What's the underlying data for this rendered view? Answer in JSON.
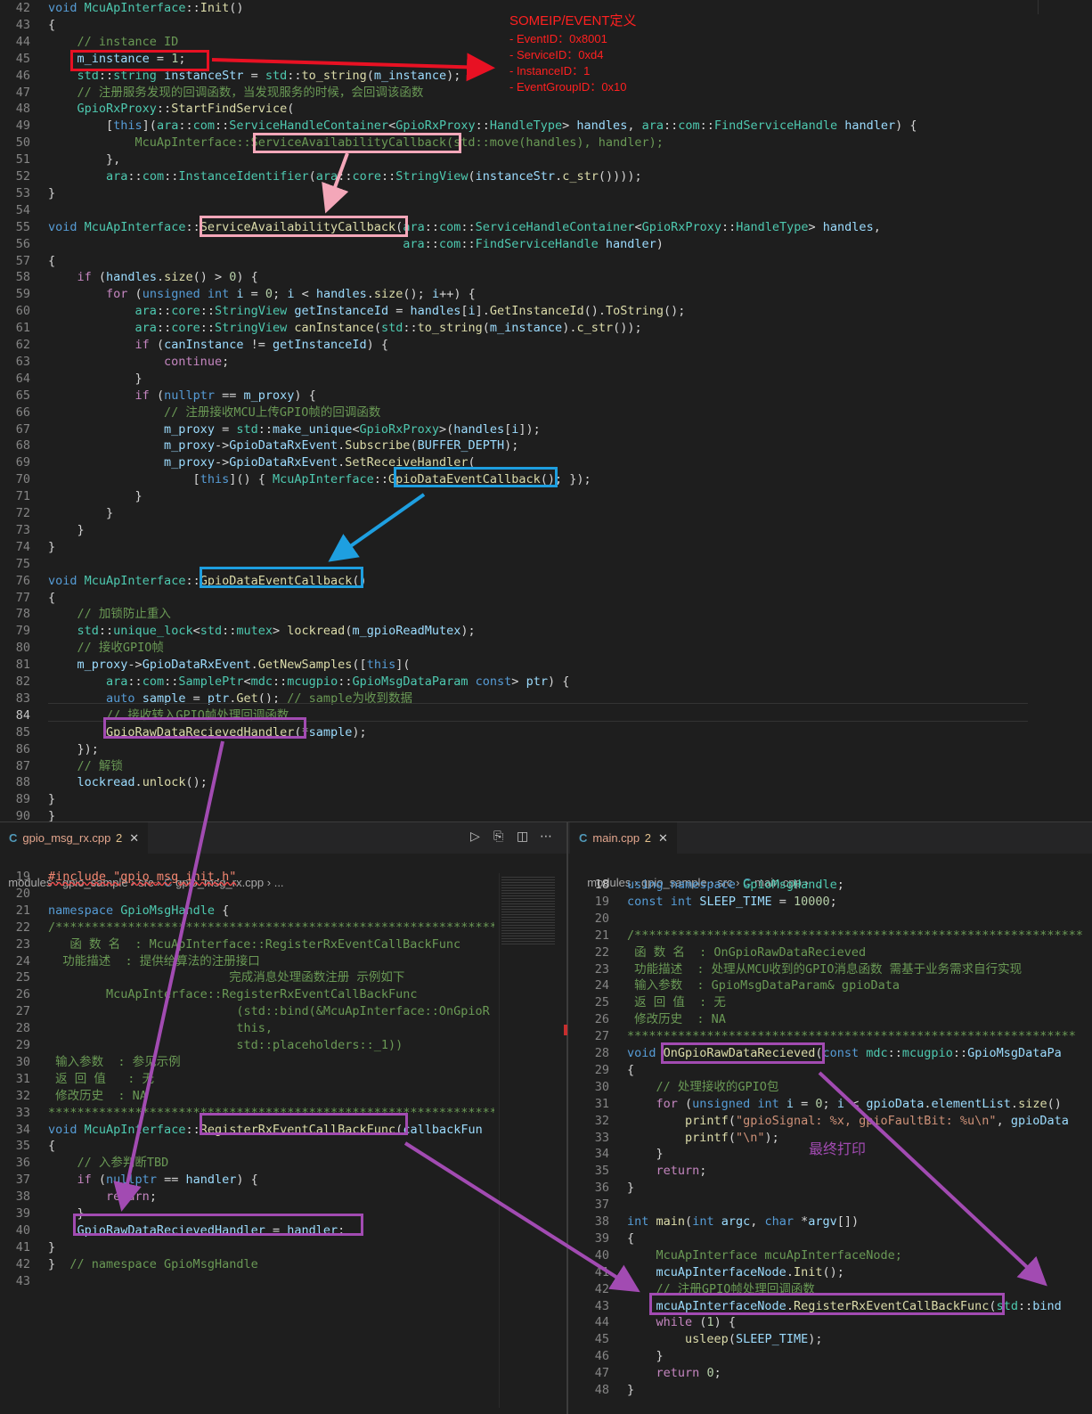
{
  "annotation": {
    "title": "SOMEIP/EVENT定义",
    "items": [
      "- EventID：0x8001",
      "- ServiceID：0xd4",
      "- InstanceID：1",
      "- EventGroupID：0x10"
    ],
    "final_print": "最终打印"
  },
  "top_editor": {
    "lines": [
      {
        "n": "42",
        "t": "void McuApInterface::Init()"
      },
      {
        "n": "43",
        "t": "{"
      },
      {
        "n": "44",
        "t": "    // instance ID"
      },
      {
        "n": "45",
        "t": "    m_instance = 1;"
      },
      {
        "n": "46",
        "t": "    std::string instanceStr = std::to_string(m_instance);"
      },
      {
        "n": "47",
        "t": "    // 注册服务发现的回调函数，当发现服务的时候，会回调该函数"
      },
      {
        "n": "48",
        "t": "    GpioRxProxy::StartFindService("
      },
      {
        "n": "49",
        "t": "        [this](ara::com::ServiceHandleContainer<GpioRxProxy::HandleType> handles, ara::com::FindServiceHandle handler) {"
      },
      {
        "n": "50",
        "t": "            McuApInterface::ServiceAvailabilityCallback(std::move(handles), handler);"
      },
      {
        "n": "51",
        "t": "        },"
      },
      {
        "n": "52",
        "t": "        ara::com::InstanceIdentifier(ara::core::StringView(instanceStr.c_str())));"
      },
      {
        "n": "53",
        "t": "}"
      },
      {
        "n": "54",
        "t": ""
      },
      {
        "n": "55",
        "t": "void McuApInterface::ServiceAvailabilityCallback(ara::com::ServiceHandleContainer<GpioRxProxy::HandleType> handles,"
      },
      {
        "n": "56",
        "t": "                                                 ara::com::FindServiceHandle handler)"
      },
      {
        "n": "57",
        "t": "{"
      },
      {
        "n": "58",
        "t": "    if (handles.size() > 0) {"
      },
      {
        "n": "59",
        "t": "        for (unsigned int i = 0; i < handles.size(); i++) {"
      },
      {
        "n": "60",
        "t": "            ara::core::StringView getInstanceId = handles[i].GetInstanceId().ToString();"
      },
      {
        "n": "61",
        "t": "            ara::core::StringView canInstance(std::to_string(m_instance).c_str());"
      },
      {
        "n": "62",
        "t": "            if (canInstance != getInstanceId) {"
      },
      {
        "n": "63",
        "t": "                continue;"
      },
      {
        "n": "64",
        "t": "            }"
      },
      {
        "n": "65",
        "t": "            if (nullptr == m_proxy) {"
      },
      {
        "n": "66",
        "t": "                // 注册接收MCU上传GPIO帧的回调函数"
      },
      {
        "n": "67",
        "t": "                m_proxy = std::make_unique<GpioRxProxy>(handles[i]);"
      },
      {
        "n": "68",
        "t": "                m_proxy->GpioDataRxEvent.Subscribe(BUFFER_DEPTH);"
      },
      {
        "n": "69",
        "t": "                m_proxy->GpioDataRxEvent.SetReceiveHandler("
      },
      {
        "n": "70",
        "t": "                    [this]() { McuApInterface::GpioDataEventCallback(); });"
      },
      {
        "n": "71",
        "t": "            }"
      },
      {
        "n": "72",
        "t": "        }"
      },
      {
        "n": "73",
        "t": "    }"
      },
      {
        "n": "74",
        "t": "}"
      },
      {
        "n": "75",
        "t": ""
      },
      {
        "n": "76",
        "t": "void McuApInterface::GpioDataEventCallback()"
      },
      {
        "n": "77",
        "t": "{"
      },
      {
        "n": "78",
        "t": "    // 加锁防止重入"
      },
      {
        "n": "79",
        "t": "    std::unique_lock<std::mutex> lockread(m_gpioReadMutex);"
      },
      {
        "n": "80",
        "t": "    // 接收GPIO帧"
      },
      {
        "n": "81",
        "t": "    m_proxy->GpioDataRxEvent.GetNewSamples([this]("
      },
      {
        "n": "82",
        "t": "        ara::com::SamplePtr<mdc::mcugpio::GpioMsgDataParam const> ptr) {"
      },
      {
        "n": "83",
        "t": "        auto sample = ptr.Get(); // sample为收到数据"
      },
      {
        "n": "84",
        "t": "        // 接收转入GPIO帧处理回调函数"
      },
      {
        "n": "85",
        "t": "        GpioRawDataRecievedHandler(*sample);"
      },
      {
        "n": "86",
        "t": "    });"
      },
      {
        "n": "87",
        "t": "    // 解锁"
      },
      {
        "n": "88",
        "t": "    lockread.unlock();"
      },
      {
        "n": "89",
        "t": "}"
      },
      {
        "n": "90",
        "t": "}"
      }
    ]
  },
  "left_pane": {
    "tab": {
      "icon": "C",
      "filename": "gpio_msg_rx.cpp",
      "problems": "2"
    },
    "breadcrumb": [
      "modules",
      "gpio_sample",
      "src",
      "gpio_msg_rx.cpp",
      "..."
    ],
    "lines": [
      {
        "n": "19",
        "t": "#include \"gpio_msg_init.h\""
      },
      {
        "n": "20",
        "t": ""
      },
      {
        "n": "21",
        "t": "namespace GpioMsgHandle {"
      },
      {
        "n": "22",
        "t": "/**************************************************************"
      },
      {
        "n": "23",
        "t": "   函 数 名  : McuApInterface::RegisterRxEventCallBackFunc"
      },
      {
        "n": "24",
        "t": "  功能描述  : 提供给算法的注册接口"
      },
      {
        "n": "25",
        "t": "                         完成消息处理函数注册 示例如下"
      },
      {
        "n": "26",
        "t": "        McuApInterface::RegisterRxEventCallBackFunc"
      },
      {
        "n": "27",
        "t": "                          (std::bind(&McuApInterface::OnGpioR"
      },
      {
        "n": "28",
        "t": "                          this,"
      },
      {
        "n": "29",
        "t": "                          std::placeholders::_1))"
      },
      {
        "n": "30",
        "t": " 输入参数  : 参见示例"
      },
      {
        "n": "31",
        "t": " 返 回 值   : 无"
      },
      {
        "n": "32",
        "t": " 修改历史  : NA"
      },
      {
        "n": "33",
        "t": "**************************************************************"
      },
      {
        "n": "34",
        "t": "void McuApInterface::RegisterRxEventCallBackFunc(callbackFun"
      },
      {
        "n": "35",
        "t": "{"
      },
      {
        "n": "36",
        "t": "    // 入参判断TBD"
      },
      {
        "n": "37",
        "t": "    if (nullptr == handler) {"
      },
      {
        "n": "38",
        "t": "        return;"
      },
      {
        "n": "39",
        "t": "    }"
      },
      {
        "n": "40",
        "t": "    GpioRawDataRecievedHandler = handler;"
      },
      {
        "n": "41",
        "t": "}"
      },
      {
        "n": "42",
        "t": "}  // namespace GpioMsgHandle"
      },
      {
        "n": "43",
        "t": ""
      }
    ]
  },
  "right_pane": {
    "tab": {
      "icon": "C",
      "filename": "main.cpp",
      "problems": "2"
    },
    "breadcrumb": [
      "modules",
      "gpio_sample",
      "src",
      "main.cpp",
      "..."
    ],
    "lines": [
      {
        "n": "18",
        "t": "using namespace GpioMsgHandle;"
      },
      {
        "n": "19",
        "t": "const int SLEEP_TIME = 10000;"
      },
      {
        "n": "20",
        "t": ""
      },
      {
        "n": "21",
        "t": "/**************************************************************"
      },
      {
        "n": "22",
        "t": " 函 数 名  : OnGpioRawDataRecieved"
      },
      {
        "n": "23",
        "t": " 功能描述  : 处理从MCU收到的GPIO消息函数 需基于业务需求自行实现"
      },
      {
        "n": "24",
        "t": " 输入参数  : GpioMsgDataParam& gpioData"
      },
      {
        "n": "25",
        "t": " 返 回 值  : 无"
      },
      {
        "n": "26",
        "t": " 修改历史  : NA"
      },
      {
        "n": "27",
        "t": "**************************************************************"
      },
      {
        "n": "28",
        "t": "void OnGpioRawDataRecieved(const mdc::mcugpio::GpioMsgDataPa"
      },
      {
        "n": "29",
        "t": "{"
      },
      {
        "n": "30",
        "t": "    // 处理接收的GPIO包"
      },
      {
        "n": "31",
        "t": "    for (unsigned int i = 0; i < gpioData.elementList.size()"
      },
      {
        "n": "32",
        "t": "        printf(\"gpioSignal: %x, gpioFaultBit: %u\\n\", gpioData"
      },
      {
        "n": "33",
        "t": "        printf(\"\\n\");"
      },
      {
        "n": "34",
        "t": "    }"
      },
      {
        "n": "35",
        "t": "    return;"
      },
      {
        "n": "36",
        "t": "}"
      },
      {
        "n": "37",
        "t": ""
      },
      {
        "n": "38",
        "t": "int main(int argc, char *argv[])"
      },
      {
        "n": "39",
        "t": "{"
      },
      {
        "n": "40",
        "t": "    McuApInterface mcuApInterfaceNode;"
      },
      {
        "n": "41",
        "t": "    mcuApInterfaceNode.Init();"
      },
      {
        "n": "42",
        "t": "    // 注册GPIO帧处理回调函数"
      },
      {
        "n": "43",
        "t": "    mcuApInterfaceNode.RegisterRxEventCallBackFunc(std::bind"
      },
      {
        "n": "44",
        "t": "    while (1) {"
      },
      {
        "n": "45",
        "t": "        usleep(SLEEP_TIME);"
      },
      {
        "n": "46",
        "t": "    }"
      },
      {
        "n": "47",
        "t": "    return 0;"
      },
      {
        "n": "48",
        "t": "}"
      }
    ]
  },
  "colors": {
    "red": "#e81123",
    "pink": "#f4a7b9",
    "blue": "#1e9fe0",
    "purple": "#a24bb2"
  }
}
